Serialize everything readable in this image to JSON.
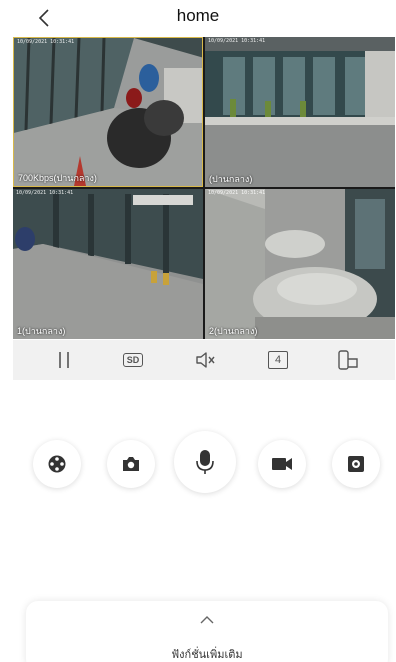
{
  "header": {
    "title": "home",
    "back_icon": "chevron-left-icon"
  },
  "cameras": [
    {
      "label": "700Kbps(ปานกลาง)",
      "timestamp": "10/09/2021 10:31:41"
    },
    {
      "label": "(ปานกลาง)",
      "timestamp": "10/09/2021 10:31:41"
    },
    {
      "label": "1(ปานกลาง)",
      "timestamp": "10/09/2021 10:31:41"
    },
    {
      "label": "2(ปานกลาง)",
      "timestamp": "10/09/2021 10:31:41"
    }
  ],
  "toolbar": {
    "pause_icon": "pause-icon",
    "quality_label": "SD",
    "mute_icon": "speaker-muted-icon",
    "split_count": "4",
    "orientation_icon": "rotate-screen-icon"
  },
  "actions": [
    {
      "icon": "ptz-control-icon"
    },
    {
      "icon": "camera-icon"
    },
    {
      "icon": "microphone-icon"
    },
    {
      "icon": "video-record-icon"
    },
    {
      "icon": "settings-icon"
    }
  ],
  "more_panel": {
    "label": "ฟังก์ชั่นเพิ่มเติม",
    "icon": "chevron-up-icon"
  },
  "colors": {
    "selected_border": "#d8b94a",
    "toolbar_bg": "#f1f1f1",
    "icon_dark": "#333333"
  }
}
